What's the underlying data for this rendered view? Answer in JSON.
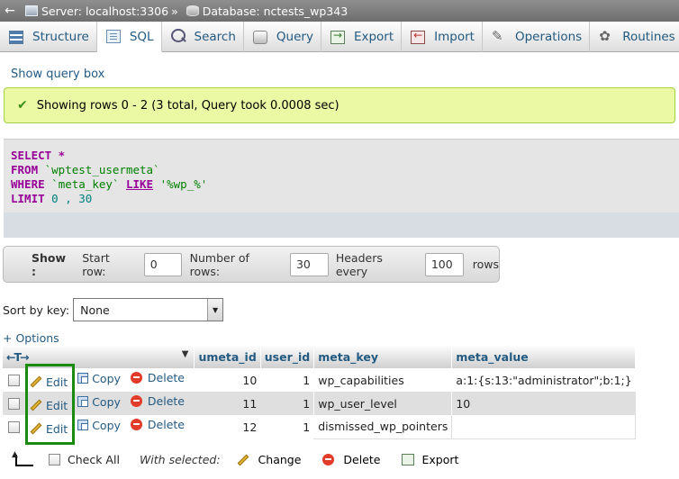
{
  "breadcrumb": {
    "back": "←",
    "server": "Server: localhost:3306",
    "separator": "»",
    "database": "Database: nctests_wp343"
  },
  "tabs": [
    {
      "label": "Structure",
      "icon": "structure-icon"
    },
    {
      "label": "SQL",
      "icon": "sql-icon",
      "active": true
    },
    {
      "label": "Search",
      "icon": "search-icon"
    },
    {
      "label": "Query",
      "icon": "query-icon"
    },
    {
      "label": "Export",
      "icon": "export-icon"
    },
    {
      "label": "Import",
      "icon": "import-icon"
    },
    {
      "label": "Operations",
      "icon": "operations-icon"
    },
    {
      "label": "Routines",
      "icon": "routines-icon"
    }
  ],
  "show_query_box": "Show query box",
  "success_message": "Showing rows 0 - 2 (3 total, Query took 0.0008 sec)",
  "sql": {
    "select_kw": "SELECT",
    "select_rest": " *",
    "from_kw": "FROM",
    "table": " `wptest_usermeta`",
    "where_kw": "WHERE",
    "where_col": " `meta_key` ",
    "like_kw": "LIKE",
    "pattern": " '%wp_%'",
    "limit_kw": "LIMIT",
    "limit_vals": " 0 , 30"
  },
  "show_bar": {
    "show_label": "Show :",
    "start_row_label": "Start row:",
    "start_row_value": "0",
    "num_rows_label": "Number of rows:",
    "num_rows_value": "30",
    "headers_every_label": "Headers every",
    "headers_every_value": "100",
    "rows_label": "rows"
  },
  "sort_by_key": {
    "label": "Sort by key:",
    "value": "None"
  },
  "options_link": "+ Options",
  "table": {
    "option_arrows": "←T→",
    "headers": [
      "umeta_id",
      "user_id",
      "meta_key",
      "meta_value"
    ],
    "actions": {
      "edit": "Edit",
      "copy": "Copy",
      "delete": "Delete"
    },
    "rows": [
      {
        "umeta_id": "10",
        "user_id": "1",
        "meta_key": "wp_capabilities",
        "meta_value": "a:1:{s:13:\"administrator\";b:1;}"
      },
      {
        "umeta_id": "11",
        "user_id": "1",
        "meta_key": "wp_user_level",
        "meta_value": "10"
      },
      {
        "umeta_id": "12",
        "user_id": "1",
        "meta_key": "dismissed_wp_pointers",
        "meta_value": ""
      }
    ]
  },
  "bottom": {
    "check_all": "Check All",
    "with_selected": "With selected:",
    "change": "Change",
    "delete": "Delete",
    "export": "Export"
  },
  "colors": {
    "link": "#235a81",
    "success_bg": "#ebf8a4",
    "highlight_box": "#1a8a10"
  }
}
